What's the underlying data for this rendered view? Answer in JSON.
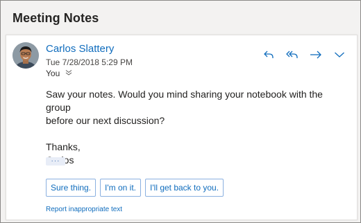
{
  "subject": "Meeting Notes",
  "message": {
    "sender": "Carlos Slattery",
    "date": "Tue 7/28/2018 5:29 PM",
    "recipient": "You",
    "body": {
      "line1": "Saw your notes. Would you mind sharing your notebook with the group",
      "line2": "before our next discussion?",
      "signoff": "Thanks,",
      "signature": "Carlos"
    },
    "show_more": "···"
  },
  "actions": {
    "icons": [
      "reply-icon",
      "reply-all-icon",
      "forward-icon",
      "more-chevron-icon"
    ],
    "color": "#0f6cbd"
  },
  "suggested_replies": [
    {
      "label": "Sure thing."
    },
    {
      "label": "I'm on it."
    },
    {
      "label": "I'll get back to you."
    }
  ],
  "report_link": "Report inappropriate text"
}
